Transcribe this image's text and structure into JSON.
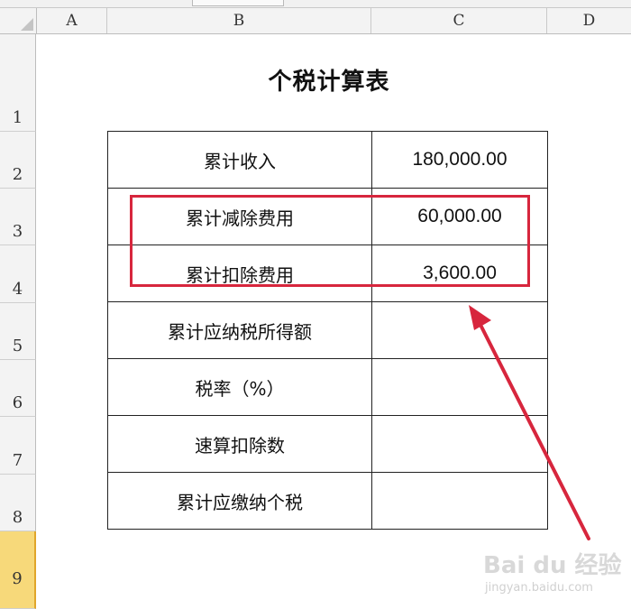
{
  "columns": [
    "A",
    "B",
    "C",
    "D"
  ],
  "rows": [
    "1",
    "2",
    "3",
    "4",
    "5",
    "6",
    "7",
    "8",
    "9"
  ],
  "selected_row": "9",
  "sheet": {
    "title": "个税计算表",
    "table": [
      {
        "label": "累计收入",
        "value": "180,000.00"
      },
      {
        "label": "累计减除费用",
        "value": "60,000.00"
      },
      {
        "label": "累计扣除费用",
        "value": "3,600.00"
      },
      {
        "label": "累计应纳税所得额",
        "value": ""
      },
      {
        "label": "税率（%）",
        "value": ""
      },
      {
        "label": "速算扣除数",
        "value": ""
      },
      {
        "label": "累计应缴纳个税",
        "value": ""
      }
    ]
  },
  "annotation": {
    "color": "#d7263d",
    "highlighted_rows": [
      "3",
      "4"
    ]
  },
  "watermark": {
    "main": "Bai du 经验",
    "sub": "jingyan.baidu.com"
  }
}
